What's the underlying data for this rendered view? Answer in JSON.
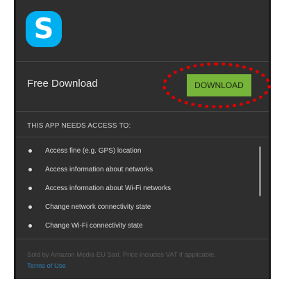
{
  "app": {
    "logo_letter": "S",
    "logo_color": "#00aff0"
  },
  "offer": {
    "price_label": "Free Download",
    "download_label": "DOWNLOAD",
    "button_color": "#76b43a"
  },
  "permissions": {
    "heading": "THIS APP NEEDS ACCESS TO:",
    "items": [
      "Access fine (e.g. GPS) location",
      "Access information about networks",
      "Access information about Wi-Fi networks",
      "Change network connectivity state",
      "Change Wi-Fi connectivity state"
    ]
  },
  "footer": {
    "seller_text": "Sold by Amazon Media EU Sarl. Price includes VAT if applicable.",
    "terms_label": "Terms of Use"
  },
  "annotation": {
    "highlight_color": "#e00000"
  }
}
